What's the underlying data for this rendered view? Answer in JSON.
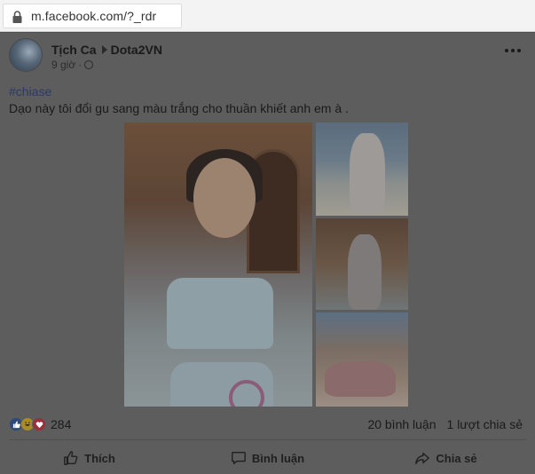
{
  "browser": {
    "url": "m.facebook.com/?_rdr",
    "lock_icon": "lock-icon"
  },
  "post": {
    "author": "Tịch Ca",
    "group": "Dota2VN",
    "time": "9 giờ",
    "hashtag": "#chiase",
    "caption": "Dạo này tôi đổi gu sang màu trắng cho thuần khiết anh em à .",
    "reactions_count": "284",
    "comments": "20 bình luận",
    "shares": "1 lượt chia sẻ"
  },
  "actions": {
    "like": "Thích",
    "comment": "Bình luận",
    "share": "Chia sẻ"
  },
  "icons": {
    "more": "more-icon",
    "globe": "globe-icon",
    "like": "thumbs-up-icon",
    "comment": "comment-icon",
    "share": "share-icon"
  },
  "colors": {
    "overlay": "#5d5d5d",
    "hashtag": "#2c3a66"
  }
}
